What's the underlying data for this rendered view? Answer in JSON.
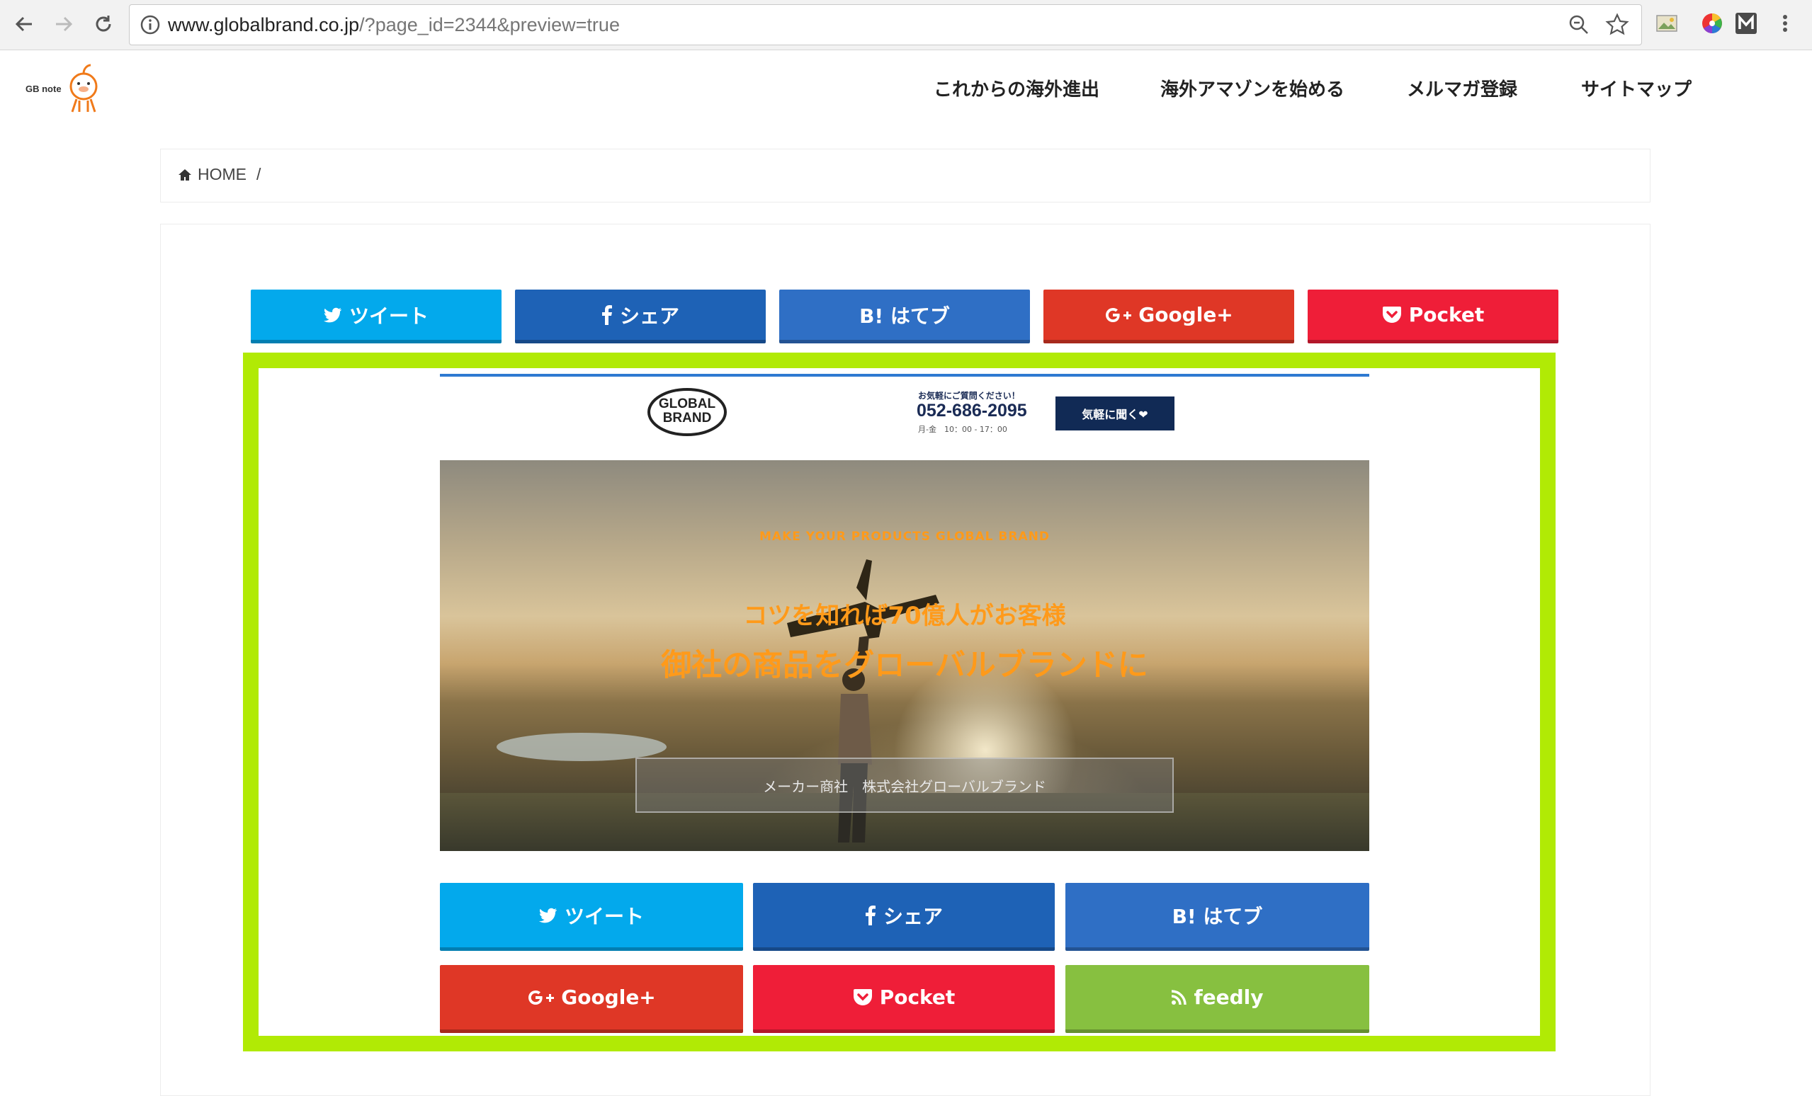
{
  "browser": {
    "url_host": "www.globalbrand.co.jp",
    "url_rest": "/?page_id=2344&preview=true"
  },
  "site": {
    "logo_text": "GB note",
    "nav": [
      "これからの海外進出",
      "海外アマゾンを始める",
      "メルマガ登録",
      "サイトマップ"
    ]
  },
  "breadcrumb": {
    "home": "HOME",
    "sep": "/"
  },
  "share_top": {
    "tweet": "ツイート",
    "share": "シェア",
    "hatena": "B! はてブ",
    "google": "Google+",
    "pocket": "Pocket"
  },
  "preview": {
    "logo_line1": "GLOBAL",
    "logo_line2": "BRAND",
    "contact_small": "お気軽にご質問ください！",
    "phone": "052-686-2095",
    "hours": "月-金　10：00 - 17：00",
    "ask_button": "気軽に聞く❤",
    "hero_tag": "MAKE YOUR PRODUCTS GLOBAL BRAND",
    "hero_line1": "コツを知れば70億人がお客様",
    "hero_line2": "御社の商品をグローバルブランドに",
    "hero_box": "メーカー商社　株式会社グローバルブランド"
  },
  "share_bottom": {
    "tweet": "ツイート",
    "share": "シェア",
    "hatena": "B! はてブ",
    "google": "Google+",
    "pocket": "Pocket",
    "feedly": "feedly"
  },
  "colors": {
    "twitter": "#03a9ec",
    "facebook": "#1e62b6",
    "hatena": "#2f6fc5",
    "google": "#df3726",
    "pocket": "#ef1e38",
    "feedly": "#87c040",
    "highlight_frame": "#b1ea05",
    "hero_accent": "#ff9a1a"
  }
}
